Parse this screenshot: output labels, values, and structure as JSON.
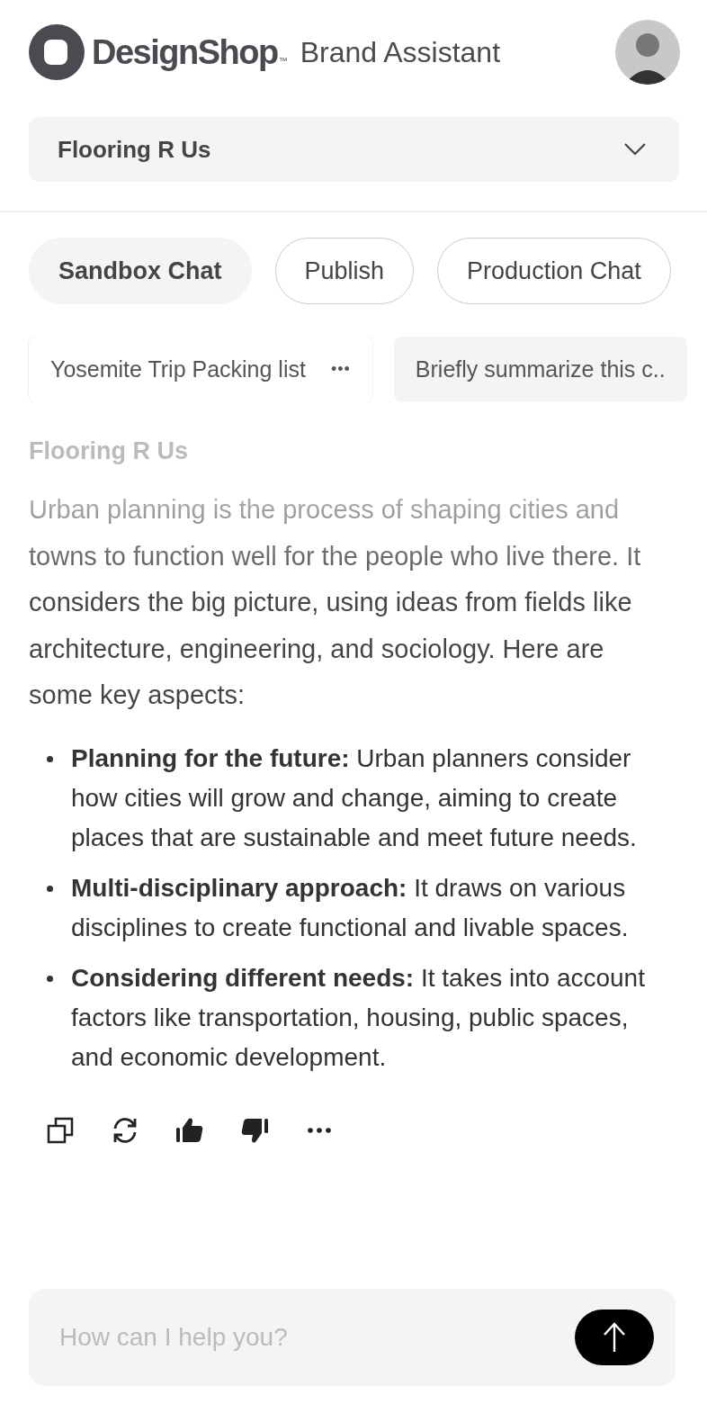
{
  "header": {
    "logo": "DesignShop",
    "trademark": "™",
    "subtitle": "Brand Assistant"
  },
  "brand_select": {
    "value": "Flooring R Us"
  },
  "tabs": [
    {
      "label": "Sandbox Chat",
      "selected": true
    },
    {
      "label": "Publish",
      "selected": false
    },
    {
      "label": "Production Chat",
      "selected": false
    }
  ],
  "conversations": [
    {
      "title": "Yosemite Trip Packing list",
      "selected": true,
      "menu": "•••"
    },
    {
      "title": "Briefly summarize this c..",
      "selected": false
    }
  ],
  "message": {
    "sender": "Flooring R Us",
    "intro": "Urban planning is the process of shaping cities and towns to function well for the people who live there. It considers the big picture, using ideas from fields like architecture, engineering, and sociology. Here are some key aspects:",
    "points": [
      {
        "text": "**Planning for the future:** Urban planners consider how cities will grow and change, aiming to create places that are sustainable and meet future needs."
      },
      {
        "text": "**Multi-disciplinary approach:**  It  draws on various disciplines to create functional and livable spaces."
      },
      {
        "text": "**Considering different needs:**  It  takes into account factors like transportation, housing, public spaces, and economic development."
      }
    ]
  },
  "actions": [
    {
      "kind": "copy"
    },
    {
      "kind": "regenerate"
    },
    {
      "kind": "like"
    },
    {
      "kind": "dislike"
    },
    {
      "kind": "more"
    }
  ],
  "composer": {
    "placeholder": "How can I help you?"
  }
}
